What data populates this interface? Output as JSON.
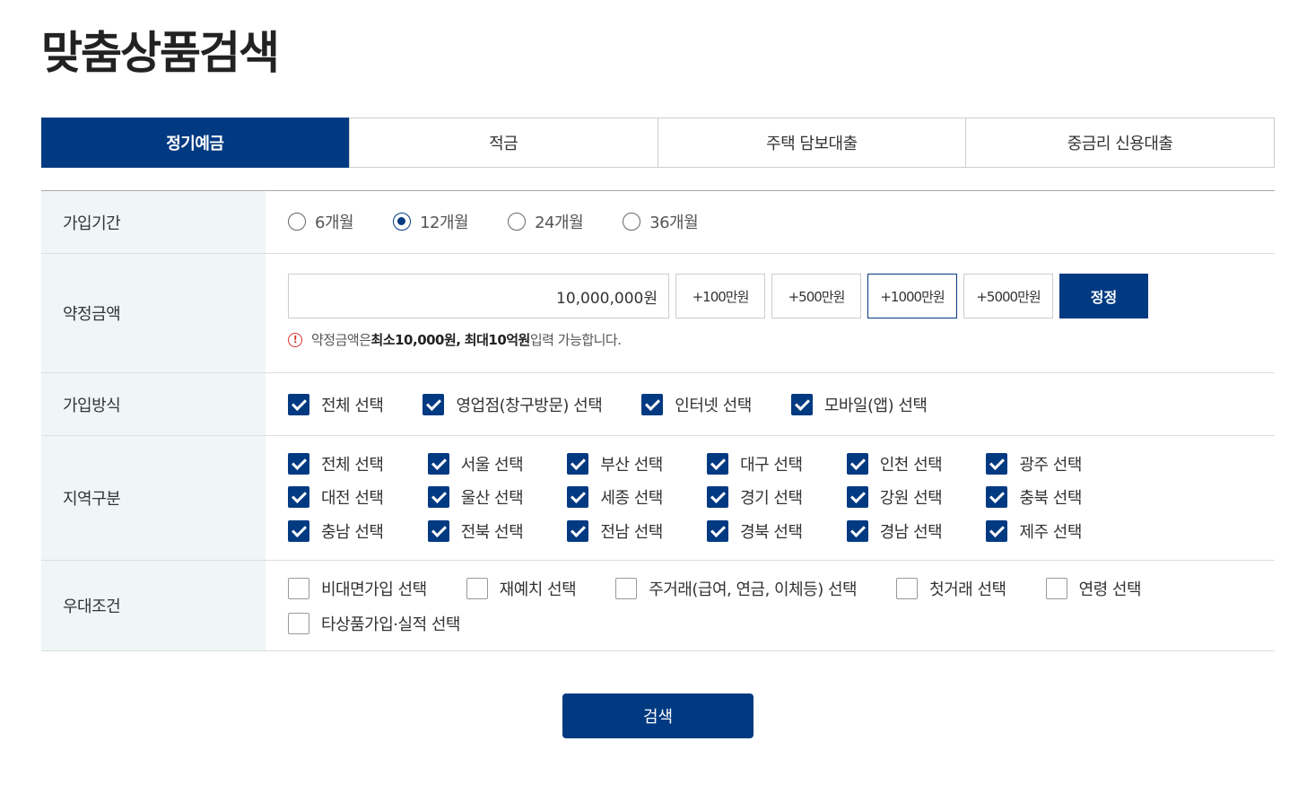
{
  "page": {
    "title": "맞춤상품검색"
  },
  "tabs": [
    {
      "label": "정기예금",
      "active": true
    },
    {
      "label": "적금",
      "active": false
    },
    {
      "label": "주택 담보대출",
      "active": false
    },
    {
      "label": "중금리 신용대출",
      "active": false
    }
  ],
  "period": {
    "label": "가입기간",
    "options": [
      {
        "label": "6개월",
        "selected": false
      },
      {
        "label": "12개월",
        "selected": true
      },
      {
        "label": "24개월",
        "selected": false
      },
      {
        "label": "36개월",
        "selected": false
      }
    ]
  },
  "amount": {
    "label": "약정금액",
    "value": "10,000,000원",
    "buttons": [
      "+100만원",
      "+500만원",
      "+1000만원",
      "+5000만원"
    ],
    "correct_label": "정정",
    "notice": {
      "prefix": "약정금액은 ",
      "min": "최소10,000원,",
      "max": "최대10억원",
      "suffix": " 입력 가능합니다."
    }
  },
  "method": {
    "label": "가입방식",
    "options": [
      {
        "label": "전체 선택",
        "checked": true
      },
      {
        "label": "영업점(창구방문) 선택",
        "checked": true
      },
      {
        "label": "인터넷 선택",
        "checked": true
      },
      {
        "label": "모바일(앱) 선택",
        "checked": true
      }
    ]
  },
  "region": {
    "label": "지역구분",
    "options": [
      {
        "label": "전체 선택",
        "checked": true
      },
      {
        "label": "서울 선택",
        "checked": true
      },
      {
        "label": "부산 선택",
        "checked": true
      },
      {
        "label": "대구 선택",
        "checked": true
      },
      {
        "label": "인천 선택",
        "checked": true
      },
      {
        "label": "광주 선택",
        "checked": true
      },
      {
        "label": "대전 선택",
        "checked": true
      },
      {
        "label": "울산 선택",
        "checked": true
      },
      {
        "label": "세종 선택",
        "checked": true
      },
      {
        "label": "경기 선택",
        "checked": true
      },
      {
        "label": "강원 선택",
        "checked": true
      },
      {
        "label": "충북 선택",
        "checked": true
      },
      {
        "label": "충남 선택",
        "checked": true
      },
      {
        "label": "전북 선택",
        "checked": true
      },
      {
        "label": "전남 선택",
        "checked": true
      },
      {
        "label": "경북 선택",
        "checked": true
      },
      {
        "label": "경남 선택",
        "checked": true
      },
      {
        "label": "제주 선택",
        "checked": true
      }
    ]
  },
  "benefit": {
    "label": "우대조건",
    "options": [
      {
        "label": "비대면가입 선택",
        "checked": false
      },
      {
        "label": "재예치 선택",
        "checked": false
      },
      {
        "label": "주거래(급여, 연금, 이체등) 선택",
        "checked": false
      },
      {
        "label": "첫거래 선택",
        "checked": false
      },
      {
        "label": "연령 선택",
        "checked": false
      },
      {
        "label": "타상품가입·실적 선택",
        "checked": false
      }
    ]
  },
  "search": {
    "label": "검색"
  },
  "colors": {
    "primary": "#023a82",
    "label_bg": "#eff6f8",
    "notice_icon": "#d8322d"
  }
}
